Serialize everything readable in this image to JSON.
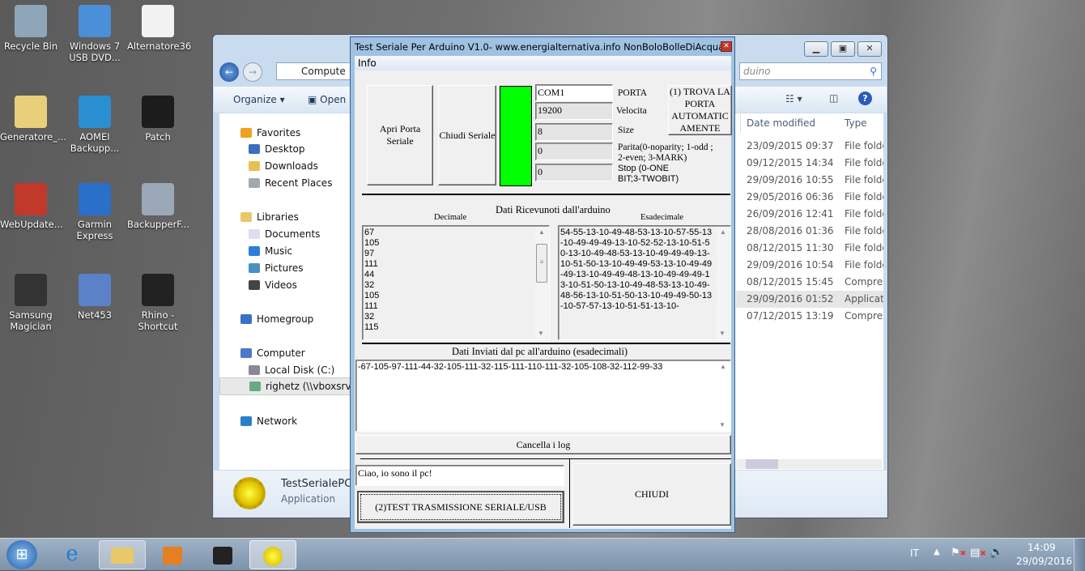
{
  "desktop": {
    "icons": [
      {
        "label": "Recycle Bin",
        "color": "#8fa6b8"
      },
      {
        "label": "Windows 7 USB DVD...",
        "color": "#4a8fd8"
      },
      {
        "label": "Alternatore36",
        "color": "#f2f2f2"
      },
      {
        "label": "Generatore_...",
        "color": "#e8cf7a"
      },
      {
        "label": "AOMEI Backupp...",
        "color": "#2a8fd0"
      },
      {
        "label": "Patch",
        "color": "#1c1c1c"
      },
      {
        "label": "WebUpdate...",
        "color": "#c0392b"
      },
      {
        "label": "Garmin Express",
        "color": "#2a6fc9"
      },
      {
        "label": "BackupperF...",
        "color": "#9aa8b8"
      },
      {
        "label": "Samsung Magician",
        "color": "#333333"
      },
      {
        "label": "Net453",
        "color": "#5b82c9"
      },
      {
        "label": "Rhino - Shortcut",
        "color": "#222222"
      }
    ]
  },
  "explorer": {
    "address": "Compute",
    "search_partial": "duino",
    "toolbar": {
      "organize": "Organize",
      "open": "Open"
    },
    "columns": {
      "date": "Date modified",
      "type": "Type"
    },
    "nav": {
      "favorites": "Favorites",
      "desktop": "Desktop",
      "downloads": "Downloads",
      "recent": "Recent Places",
      "libraries": "Libraries",
      "documents": "Documents",
      "music": "Music",
      "pictures": "Pictures",
      "videos": "Videos",
      "homegroup": "Homegroup",
      "computer": "Computer",
      "local_disk": "Local Disk (C:)",
      "share": "righetz (\\\\vboxsrv) (E:",
      "network": "Network"
    },
    "rows": [
      {
        "date": "23/09/2015 09:37",
        "type": "File folde"
      },
      {
        "date": "09/12/2015 14:34",
        "type": "File folde"
      },
      {
        "date": "29/09/2016 10:55",
        "type": "File folde"
      },
      {
        "date": "29/05/2016 06:36",
        "type": "File folde"
      },
      {
        "date": "26/09/2016 12:41",
        "type": "File folde"
      },
      {
        "date": "28/08/2016 01:36",
        "type": "File folde"
      },
      {
        "date": "08/12/2015 11:30",
        "type": "File folde"
      },
      {
        "date": "29/09/2016 10:54",
        "type": "File folde"
      },
      {
        "date": "08/12/2015 15:45",
        "type": "Compres"
      },
      {
        "date": "29/09/2016 01:52",
        "type": "Applicati"
      },
      {
        "date": "07/12/2015 13:19",
        "type": "Compres"
      }
    ],
    "details": {
      "name": "TestSerialePCP",
      "type": "Application"
    }
  },
  "dialog": {
    "title": "Test Seriale Per Arduino V1.0- www.energialternativa.info NonBoloBolleDiAcqua",
    "menu_info": "Info",
    "open_port": "Apri Porta Seriale",
    "close_serial": "Chiudi Seriale",
    "status_color": "#00ff00",
    "port": {
      "value": "COM1",
      "label": "PORTA"
    },
    "speed": {
      "value": "19200",
      "label": "Velocita"
    },
    "size": {
      "value": "8",
      "label": "Size"
    },
    "parity": {
      "value": "0",
      "label": "Parita(0-noparity; 1-odd ; 2-even; 3-MARK)"
    },
    "stop": {
      "value": "0",
      "label": "Stop (0-ONE BIT;3-TWOBIT)"
    },
    "find_port": "(1) TROVA LA PORTA AUTOMATIC AMENTE",
    "received_title": "Dati Ricevunoti dall'arduino",
    "decimal_label": "Decimale",
    "hex_label": "Esadecimale",
    "decimal_values": [
      "67",
      "105",
      "97",
      "111",
      "44",
      "32",
      "105",
      "111",
      "32",
      "115"
    ],
    "hex_text": "54-55-13-10-49-48-53-13-10-57-55-13-10-49-49-49-13-10-52-52-13-10-51-50-13-10-49-48-53-13-10-49-49-49-13-10-51-50-13-10-49-49-53-13-10-49-49-49-13-10-49-49-48-13-10-49-49-49-13-10-51-50-13-10-49-48-53-13-10-49-48-56-13-10-51-50-13-10-49-49-50-13-10-57-57-13-10-51-51-13-10-",
    "sent_title": "Dati Inviati dal pc all'arduino (esadecimali)",
    "sent_text": "-67-105-97-111-44-32-105-111-32-115-111-110-111-32-105-108-32-112-99-33",
    "clear_log": "Cancella i log",
    "message_input": "Ciao, io sono il pc!",
    "test_button": "(2)TEST TRASMISSIONE SERIALE/USB",
    "close_button": "CHIUDI"
  },
  "taskbar": {
    "lang": "IT",
    "time": "14:09",
    "date": "29/09/2016"
  }
}
